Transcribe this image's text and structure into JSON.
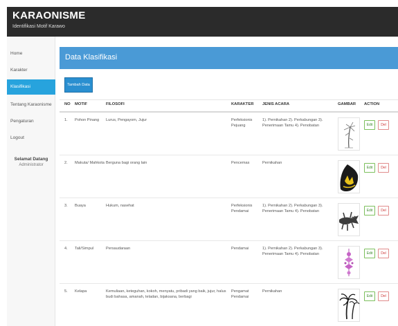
{
  "app": {
    "brand": "KARAONISME",
    "subtitle": "Identifikasi Motif Karawo"
  },
  "sidebar": {
    "items": [
      {
        "label": "Home"
      },
      {
        "label": "Karakter"
      },
      {
        "label": "Klasifikasi",
        "active": true
      },
      {
        "label": "Tentang Karaonisme"
      },
      {
        "label": "Pengaturan"
      },
      {
        "label": "Logout"
      }
    ],
    "welcome": "Selamat Datang",
    "user": "Administrator"
  },
  "panel": {
    "title": "Data Klasifikasi",
    "add_button": "Tambah Data"
  },
  "table": {
    "headers": [
      "NO",
      "MOTIF",
      "FILOSOFI",
      "KARAKTER",
      "JENIS ACARA",
      "GAMBAR",
      "ACTION"
    ],
    "rows": [
      {
        "no": "1.",
        "motif": "Pohon Pinang",
        "filosofi": "Lurus, Pengayom, Jujur",
        "karakter": "Perfeksionis Pejuang",
        "jenis_acara": "1). Pernikahan 2). Perkabungan 3). Penerimaan Tamu 4). Penobatan",
        "gambar": "palm-sketch-icon"
      },
      {
        "no": "2.",
        "motif": "Makuta/ Mahkota",
        "filosofi": "Berguna bagi orang lain",
        "karakter": "Pencemas",
        "jenis_acara": "Pernikahan",
        "gambar": "crown-icon"
      },
      {
        "no": "3.",
        "motif": "Buaya",
        "filosofi": "Hukum, nasehat",
        "karakter": "Perfeksionis Pendamai",
        "jenis_acara": "1). Pernikahan 2). Perkabungan 3). Penerimaan Tamu 4). Penobatan",
        "gambar": "crocodile-icon"
      },
      {
        "no": "4.",
        "motif": "Tali/Simpul",
        "filosofi": "Persaudaraan",
        "karakter": "Pendamai",
        "jenis_acara": "1). Pernikahan 2). Perkabungan 3). Penerimaan Tamu 4). Penobatan",
        "gambar": "knot-icon"
      },
      {
        "no": "5.",
        "motif": "Kelapa",
        "filosofi": "Kemuliaan, keteguhan, kokoh, menyatu, pribadi yang baik, jujur, halus budi bahasa, amanah, teladan, bijaksana, berbagi",
        "karakter": "Pengamat Pendamai",
        "jenis_acara": "Pernikahan",
        "gambar": "coconut-tree-icon"
      }
    ],
    "edit_label": "Edit",
    "del_label": "Del"
  },
  "colors": {
    "topbar": "#2b2b2b",
    "accent": "#27a3dd",
    "panel_header": "#4a9ad6",
    "edit": "#3c8a2d",
    "delete": "#cc3333"
  }
}
